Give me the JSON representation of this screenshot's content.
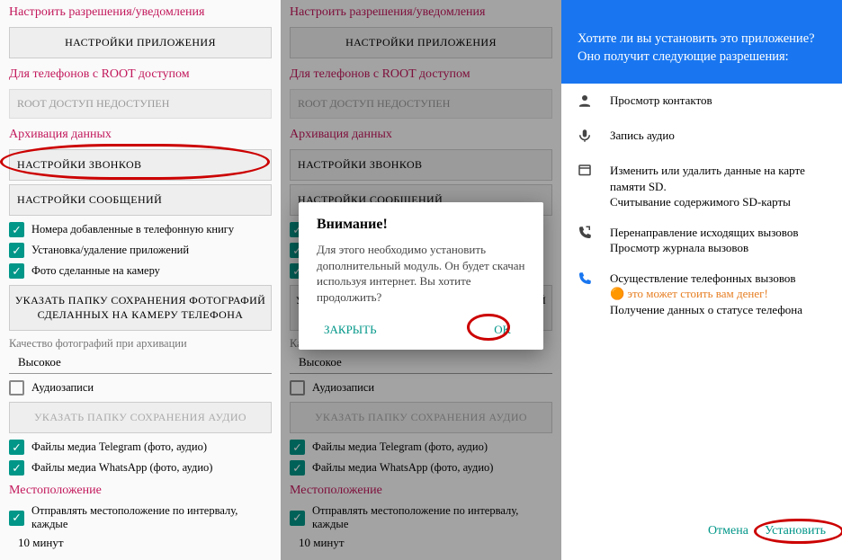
{
  "col1": {
    "title_perm": "Настроить разрешения/уведомления",
    "btn_app": "НАСТРОЙКИ ПРИЛОЖЕНИЯ",
    "title_root": "Для телефонов с ROOT доступом",
    "root_status": "ROOT ДОСТУП НЕДОСТУПЕН",
    "title_archive": "Архивация данных",
    "btn_calls": "НАСТРОЙКИ ЗВОНКОВ",
    "btn_msgs": "НАСТРОЙКИ СООБЩЕНИЙ",
    "chk_contacts": "Номера добавленные в телефонную книгу",
    "chk_apps": "Установка/удаление приложений",
    "chk_cam": "Фото сделанные на камеру",
    "btn_photo_folder": "УКАЗАТЬ ПАПКУ СОХРАНЕНИЯ ФОТОГРАФИЙ СДЕЛАННЫХ НА КАМЕРУ ТЕЛЕФОНА",
    "quality_label": "Качество фотографий при архивации",
    "quality_value": "Высокое",
    "chk_audio": "Аудиозаписи",
    "btn_audio_folder": "УКАЗАТЬ ПАПКУ СОХРАНЕНИЯ АУДИО",
    "chk_tg": "Файлы медиа Telegram (фото, аудио)",
    "chk_wa": "Файлы медиа WhatsApp (фото, аудио)",
    "title_loc": "Местоположение",
    "chk_loc": "Отправлять местоположение по интервалу, каждые",
    "loc_value": "10 минут"
  },
  "dialog": {
    "title": "Внимание!",
    "body": "Для этого необходимо установить дополнительный модуль. Он будет скачан используя интернет. Вы хотите продолжить?",
    "close": "ЗАКРЫТЬ",
    "ok": "OK"
  },
  "install": {
    "head": "Хотите ли вы установить это приложение? Оно получит следующие разрешения:",
    "perms": [
      {
        "icon": "contacts",
        "lines": [
          "Просмотр контактов"
        ]
      },
      {
        "icon": "mic",
        "lines": [
          "Запись аудио"
        ]
      },
      {
        "icon": "sd",
        "lines": [
          "Изменить или удалить данные на карте памяти SD.",
          "Считывание содержимого SD-карты"
        ]
      },
      {
        "icon": "callfwd",
        "lines": [
          "Перенаправление исходящих вызовов",
          "Просмотр журнала вызовов"
        ]
      },
      {
        "icon": "phone",
        "lines": [
          "Осуществление телефонных вызовов",
          "⊕ это может стоить вам денег!",
          "Получение данных о статусе телефона"
        ]
      }
    ],
    "cancel": "Отмена",
    "install": "Установить"
  }
}
